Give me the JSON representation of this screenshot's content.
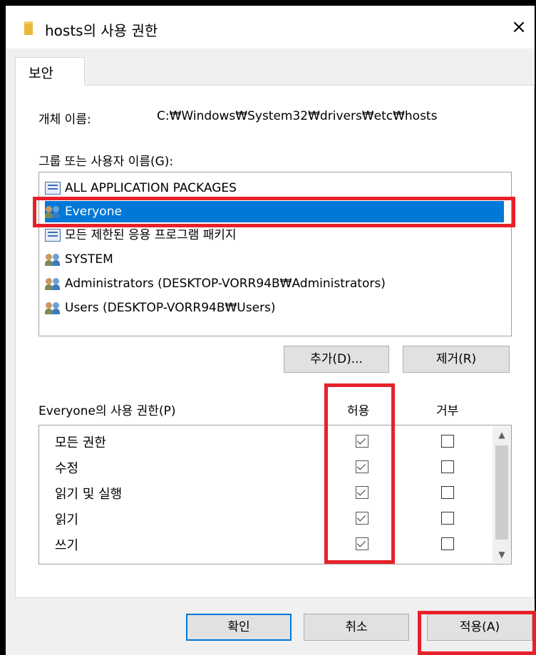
{
  "window": {
    "title": "hosts의 사용 권한",
    "close_icon": "×"
  },
  "tabs": [
    {
      "label": "보안"
    }
  ],
  "object": {
    "label": "개체 이름:",
    "path": "C:₩Windows₩System32₩drivers₩etc₩hosts"
  },
  "groups": {
    "label": "그룹 또는 사용자 이름(G):",
    "items": [
      {
        "label": "ALL APPLICATION PACKAGES",
        "icon": "package-icon",
        "selected": false
      },
      {
        "label": "Everyone",
        "icon": "users-icon",
        "selected": true
      },
      {
        "label": "모든 제한된 응용 프로그램 패키지",
        "icon": "package-icon",
        "selected": false
      },
      {
        "label": "SYSTEM",
        "icon": "users-icon",
        "selected": false
      },
      {
        "label": "Administrators (DESKTOP-VORR94B₩Administrators)",
        "icon": "users-icon",
        "selected": false
      },
      {
        "label": "Users (DESKTOP-VORR94B₩Users)",
        "icon": "users-icon",
        "selected": false
      }
    ],
    "add_button": "추가(D)...",
    "remove_button": "제거(R)"
  },
  "permissions": {
    "label": "Everyone의 사용 권한(P)",
    "allow_header": "허용",
    "deny_header": "거부",
    "rows": [
      {
        "name": "모든 권한",
        "allow": true,
        "deny": false
      },
      {
        "name": "수정",
        "allow": true,
        "deny": false
      },
      {
        "name": "읽기 및 실행",
        "allow": true,
        "deny": false
      },
      {
        "name": "읽기",
        "allow": true,
        "deny": false
      },
      {
        "name": "쓰기",
        "allow": true,
        "deny": false
      }
    ]
  },
  "buttons": {
    "ok": "확인",
    "cancel": "취소",
    "apply": "적용(A)"
  },
  "colors": {
    "selection": "#0078d7",
    "highlight": "#e8202a"
  }
}
